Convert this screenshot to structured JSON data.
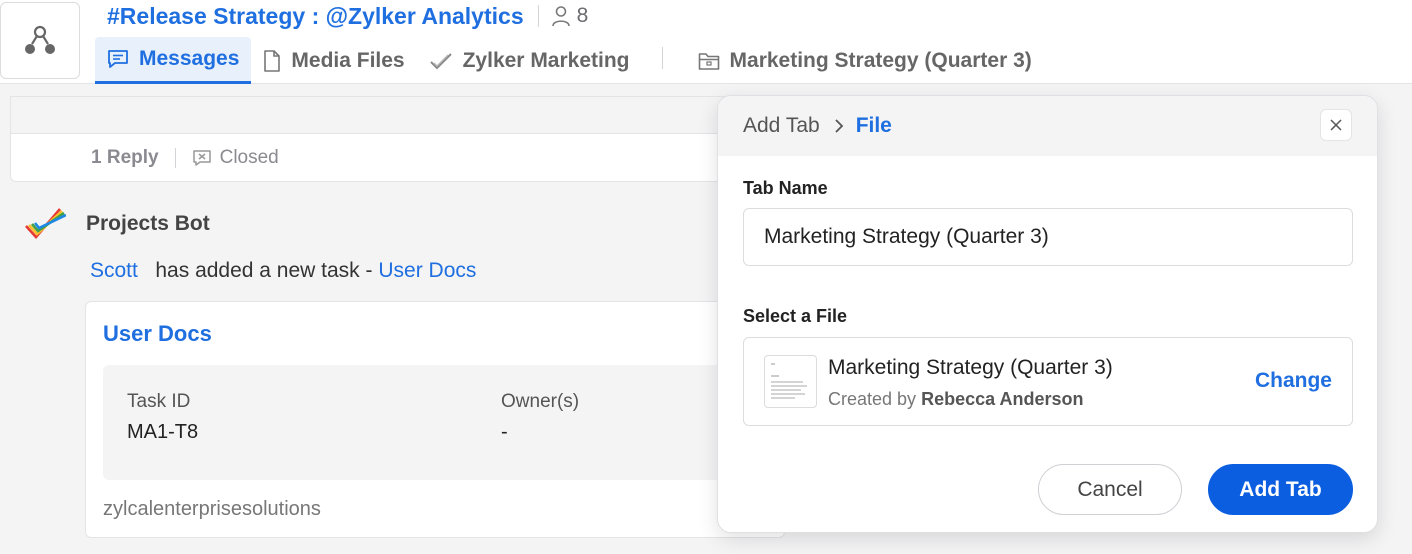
{
  "header": {
    "channel_title": "#Release Strategy : @Zylker Analytics",
    "member_count": "8",
    "tabs": [
      {
        "label": "Messages",
        "icon": "message-icon",
        "active": true
      },
      {
        "label": "Media Files",
        "icon": "file-icon",
        "active": false
      },
      {
        "label": "Zylker Marketing",
        "icon": "checkmark-icon",
        "active": false
      },
      {
        "label": "Marketing Strategy (Quarter 3)",
        "icon": "folder-icon",
        "active": false
      }
    ]
  },
  "thread": {
    "reply_count": "1 Reply",
    "status": "Closed"
  },
  "bot_message": {
    "bot_name": "Projects Bot",
    "user": "Scott",
    "action_text": "has added a new task -",
    "task_link": "User Docs",
    "card": {
      "title": "User Docs",
      "fields": [
        {
          "label": "Task ID",
          "value": "MA1-T8"
        },
        {
          "label": "Owner(s)",
          "value": "-"
        }
      ],
      "org": "zylcalenterprisesolutions"
    }
  },
  "modal": {
    "breadcrumb_root": "Add Tab",
    "breadcrumb_current": "File",
    "tab_name_label": "Tab Name",
    "tab_name_value": "Marketing Strategy (Quarter 3)",
    "select_file_label": "Select a File",
    "file_name": "Marketing Strategy (Quarter 3)",
    "created_by_prefix": "Created by",
    "created_by_name": "Rebecca Anderson",
    "change_label": "Change",
    "cancel_label": "Cancel",
    "add_label": "Add Tab"
  },
  "colors": {
    "accent": "#1f6fe0",
    "primary_button": "#0b5ee0",
    "background": "#f4f4f5"
  }
}
